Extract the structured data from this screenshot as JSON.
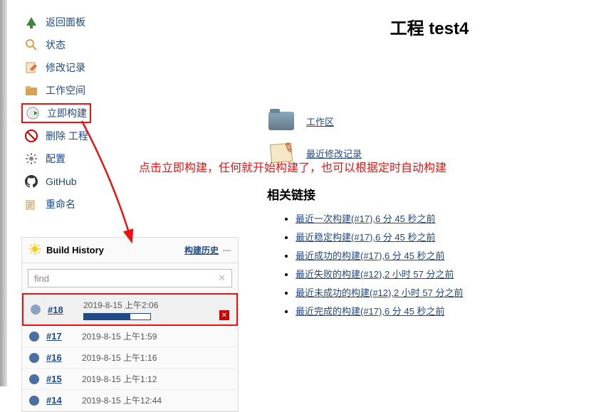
{
  "nav": {
    "back": "返回面板",
    "status": "状态",
    "changes": "修改记录",
    "workspace": "工作空间",
    "build_now": "立即构建",
    "delete": "删除 工程",
    "configure": "配置",
    "github": "GitHub",
    "rename": "重命名"
  },
  "build_history": {
    "title": "Build History",
    "link": "构建历史",
    "find_placeholder": "find",
    "builds": [
      {
        "num": "#18",
        "time": "2019-8-15 上午2:06",
        "running": true
      },
      {
        "num": "#17",
        "time": "2019-8-15 上午1:59",
        "running": false
      },
      {
        "num": "#16",
        "time": "2019-8-15 上午1:16",
        "running": false
      },
      {
        "num": "#15",
        "time": "2019-8-15 上午1:12",
        "running": false
      },
      {
        "num": "#14",
        "time": "2019-8-15 上午12:44",
        "running": false
      }
    ]
  },
  "main": {
    "title": "工程 test4",
    "workspace_link": "工作区",
    "changes_link": "最近修改记录"
  },
  "annotation": "点击立即构建，任何就开始构建了，也可以根据定时自动构建",
  "related": {
    "title": "相关链接",
    "items": [
      "最近一次构建(#17),6 分 45 秒之前",
      "最近稳定构建(#17),6 分 45 秒之前",
      "最近成功的构建(#17),6 分 45 秒之前",
      "最近失败的构建(#12),2 小时 57 分之前",
      "最近未成功的构建(#12),2 小时 57 分之前",
      "最近完成的构建(#17),6 分 45 秒之前"
    ]
  }
}
